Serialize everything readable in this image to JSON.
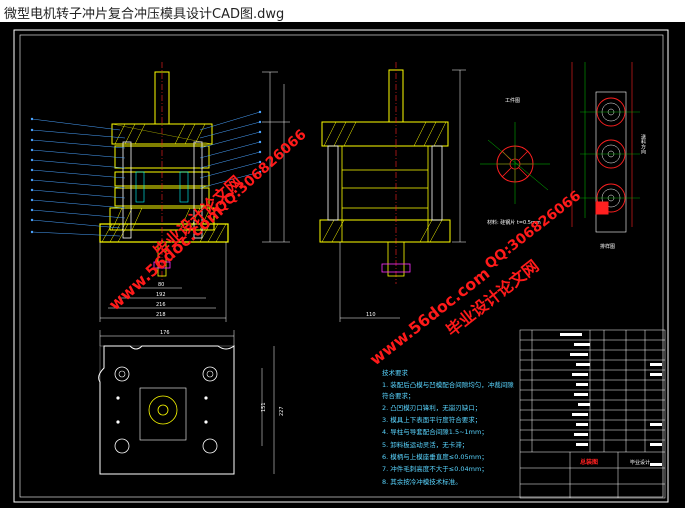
{
  "window": {
    "title": "微型电机转子冲片复合冲压模具设计CAD图.dwg"
  },
  "drawing": {
    "background": "#000000",
    "colors": {
      "frame": "#ffffff",
      "yellow": "#ffff00",
      "cyan": "#00ffff",
      "red": "#ff2020",
      "green": "#00c800",
      "blue": "#4aa3ff",
      "magenta": "#ff30ff"
    },
    "dims": {
      "front_bottom_1": "80",
      "front_bottom_2": "192",
      "front_bottom_3": "216",
      "front_bottom_4": "218",
      "side_bottom": "110",
      "plan_top": "176",
      "plan_right_1": "151",
      "plan_right_2": "227"
    },
    "tech_notes_title": "技术要求",
    "tech_notes": [
      "1. 装配后凸模与凹模配合间隙均匀，冲裁间隙符合要求；",
      "2. 凸凹模刃口锋利，无崩刃缺口；",
      "3. 模具上下表面平行度符合要求；",
      "4. 导柱与导套配合间隙1.5~1mm；",
      "5. 卸料板运动灵活，无卡滞；",
      "6. 模柄与上模座垂直度≤0.05mm；",
      "7. 冲件毛刺高度不大于≤0.04mm；",
      "8. 其余按冷冲模技术标准。"
    ],
    "strip_label": "排样图",
    "strip_side_text": "送料方向",
    "title_block": {
      "name": "总装图",
      "company": "毕业设计"
    }
  },
  "watermarks": {
    "site": "www.56doc.com",
    "brand": "毕业设计论文网",
    "qq": "QQ:306826066"
  }
}
